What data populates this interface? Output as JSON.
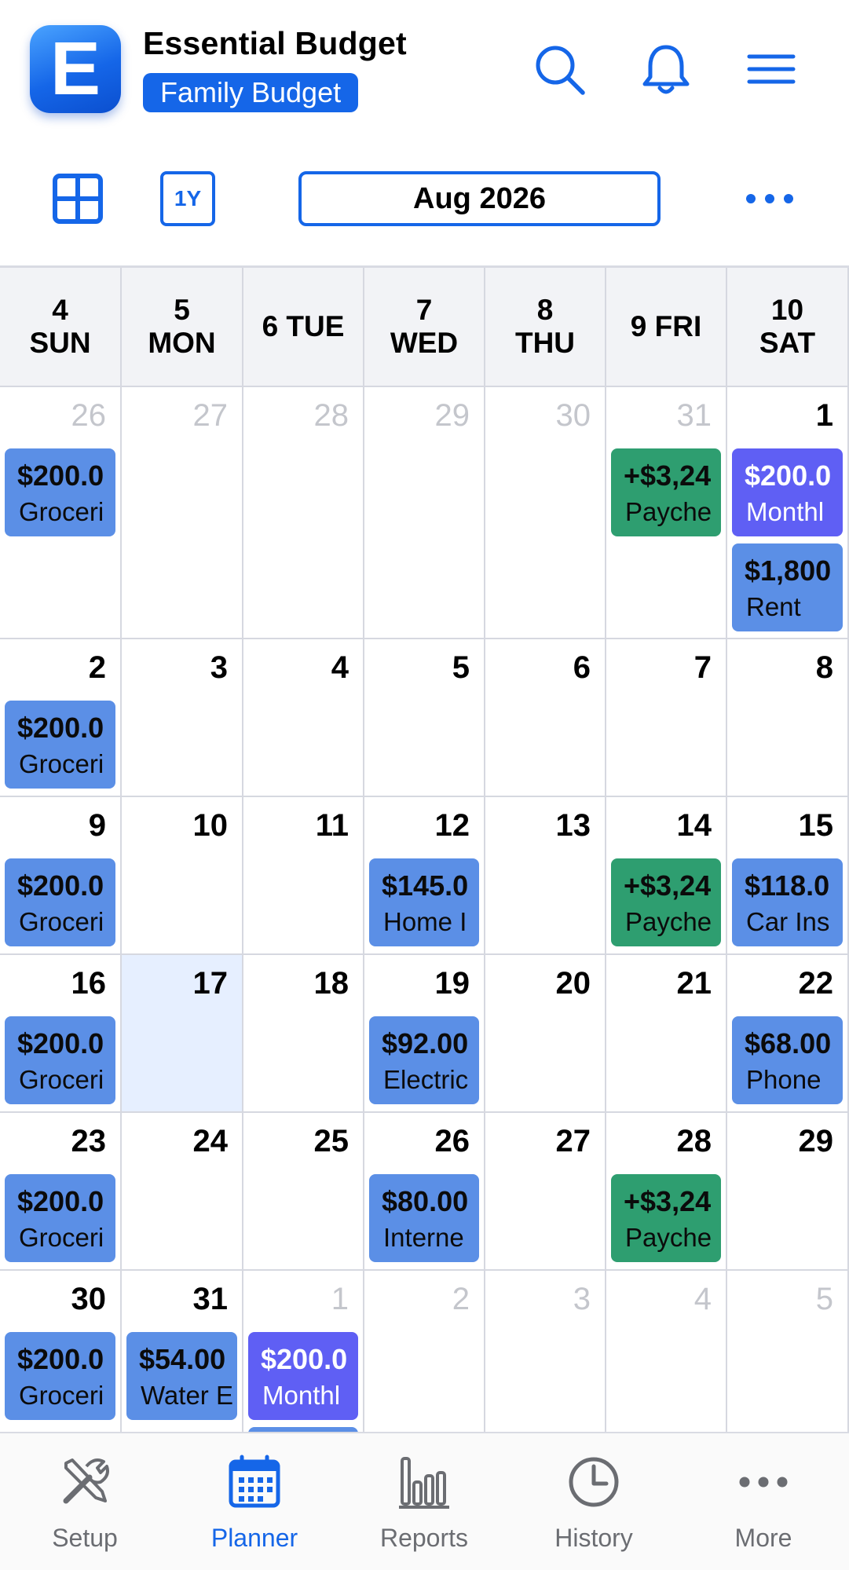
{
  "app": {
    "title": "Essential Budget",
    "budget_name": "Family Budget",
    "logo_letter": "E",
    "accent": "#1566e8"
  },
  "header": {
    "icons": [
      "search-icon",
      "bell-icon",
      "hamburger-menu-icon"
    ]
  },
  "toolbar": {
    "grid_icon": "grid-view-icon",
    "year_button": "1Y",
    "month_label": "Aug 2026",
    "more_icon": "more-dots-icon"
  },
  "calendar": {
    "columns": [
      {
        "line1": "4",
        "line2": "SUN"
      },
      {
        "line1": "5",
        "line2": "MON"
      },
      {
        "line1": "6 TUE",
        "line2": ""
      },
      {
        "line1": "7",
        "line2": "WED"
      },
      {
        "line1": "8",
        "line2": "THU"
      },
      {
        "line1": "9 FRI",
        "line2": ""
      },
      {
        "line1": "10",
        "line2": "SAT"
      }
    ],
    "weeks": [
      [
        {
          "day": "26",
          "muted": true,
          "events": [
            {
              "amount": "$200.0",
              "label": "Groceri",
              "color": "blue"
            }
          ]
        },
        {
          "day": "27",
          "muted": true,
          "events": []
        },
        {
          "day": "28",
          "muted": true,
          "events": []
        },
        {
          "day": "29",
          "muted": true,
          "events": []
        },
        {
          "day": "30",
          "muted": true,
          "events": []
        },
        {
          "day": "31",
          "muted": true,
          "events": [
            {
              "amount": "+$3,24",
              "label": "Payche",
              "color": "green"
            }
          ]
        },
        {
          "day": "1",
          "muted": false,
          "events": [
            {
              "amount": "$200.0",
              "label": "Monthl",
              "color": "violet"
            },
            {
              "amount": "$1,800",
              "label": "Rent",
              "color": "blue"
            }
          ]
        }
      ],
      [
        {
          "day": "2",
          "muted": false,
          "events": [
            {
              "amount": "$200.0",
              "label": "Groceri",
              "color": "blue"
            }
          ]
        },
        {
          "day": "3",
          "muted": false,
          "events": []
        },
        {
          "day": "4",
          "muted": false,
          "events": []
        },
        {
          "day": "5",
          "muted": false,
          "events": []
        },
        {
          "day": "6",
          "muted": false,
          "events": []
        },
        {
          "day": "7",
          "muted": false,
          "events": []
        },
        {
          "day": "8",
          "muted": false,
          "events": []
        }
      ],
      [
        {
          "day": "9",
          "muted": false,
          "events": [
            {
              "amount": "$200.0",
              "label": "Groceri",
              "color": "blue"
            }
          ]
        },
        {
          "day": "10",
          "muted": false,
          "events": []
        },
        {
          "day": "11",
          "muted": false,
          "events": []
        },
        {
          "day": "12",
          "muted": false,
          "events": [
            {
              "amount": "$145.0",
              "label": "Home I",
              "color": "blue"
            }
          ]
        },
        {
          "day": "13",
          "muted": false,
          "events": []
        },
        {
          "day": "14",
          "muted": false,
          "events": [
            {
              "amount": "+$3,24",
              "label": "Payche",
              "color": "green"
            }
          ]
        },
        {
          "day": "15",
          "muted": false,
          "events": [
            {
              "amount": "$118.0",
              "label": "Car Ins",
              "color": "blue"
            }
          ]
        }
      ],
      [
        {
          "day": "16",
          "muted": false,
          "events": [
            {
              "amount": "$200.0",
              "label": "Groceri",
              "color": "blue"
            }
          ]
        },
        {
          "day": "17",
          "muted": false,
          "today": true,
          "events": []
        },
        {
          "day": "18",
          "muted": false,
          "events": []
        },
        {
          "day": "19",
          "muted": false,
          "events": [
            {
              "amount": "$92.00",
              "label": "Electric",
              "color": "blue"
            }
          ]
        },
        {
          "day": "20",
          "muted": false,
          "events": []
        },
        {
          "day": "21",
          "muted": false,
          "events": []
        },
        {
          "day": "22",
          "muted": false,
          "events": [
            {
              "amount": "$68.00",
              "label": "Phone",
              "color": "blue"
            }
          ]
        }
      ],
      [
        {
          "day": "23",
          "muted": false,
          "events": [
            {
              "amount": "$200.0",
              "label": "Groceri",
              "color": "blue"
            }
          ]
        },
        {
          "day": "24",
          "muted": false,
          "events": []
        },
        {
          "day": "25",
          "muted": false,
          "events": []
        },
        {
          "day": "26",
          "muted": false,
          "events": [
            {
              "amount": "$80.00",
              "label": "Interne",
              "color": "blue"
            }
          ]
        },
        {
          "day": "27",
          "muted": false,
          "events": []
        },
        {
          "day": "28",
          "muted": false,
          "events": [
            {
              "amount": "+$3,24",
              "label": "Payche",
              "color": "green"
            }
          ]
        },
        {
          "day": "29",
          "muted": false,
          "events": []
        }
      ],
      [
        {
          "day": "30",
          "muted": false,
          "events": [
            {
              "amount": "$200.0",
              "label": "Groceri",
              "color": "blue"
            }
          ]
        },
        {
          "day": "31",
          "muted": false,
          "events": [
            {
              "amount": "$54.00",
              "label": "Water E",
              "color": "blue"
            }
          ]
        },
        {
          "day": "1",
          "muted": true,
          "events": [
            {
              "amount": "$200.0",
              "label": "Monthl",
              "color": "violet"
            },
            {
              "amount": "",
              "label": "",
              "color": "blue"
            }
          ]
        },
        {
          "day": "2",
          "muted": true,
          "events": []
        },
        {
          "day": "3",
          "muted": true,
          "events": []
        },
        {
          "day": "4",
          "muted": true,
          "events": []
        },
        {
          "day": "5",
          "muted": true,
          "events": []
        }
      ]
    ],
    "event_colors": {
      "blue": "#5b8fe6",
      "green": "#2e9e70",
      "violet": "#5f5ff4"
    },
    "today_color": "#e6efff"
  },
  "bottom_nav": [
    {
      "label": "Setup",
      "icon": "tools-icon",
      "active": false
    },
    {
      "label": "Planner",
      "icon": "calendar-icon",
      "active": true
    },
    {
      "label": "Reports",
      "icon": "bar-chart-icon",
      "active": false
    },
    {
      "label": "History",
      "icon": "clock-icon",
      "active": false
    },
    {
      "label": "More",
      "icon": "more-dots-icon",
      "active": false
    }
  ]
}
